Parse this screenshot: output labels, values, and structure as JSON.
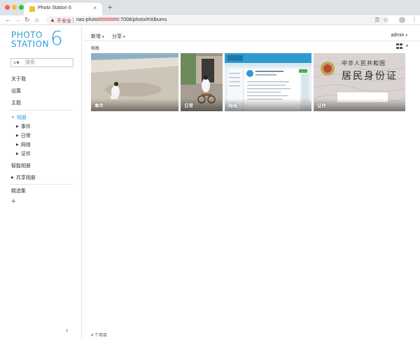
{
  "browser": {
    "tab_title": "Photo Station 6",
    "tab_close": "×",
    "new_tab": "+",
    "security_label": "不安全",
    "url_prefix": "nas-photo",
    "url_suffix": ":7008/photo/#!Albums"
  },
  "logo": {
    "line1": "PHOTO",
    "line2": "STATION",
    "version": "6"
  },
  "sidebar": {
    "search_placeholder": "搜索",
    "items": [
      {
        "label": "关于我"
      },
      {
        "label": "设置"
      },
      {
        "label": "主题"
      }
    ],
    "albums": {
      "label": "相册",
      "children": [
        {
          "label": "事件"
        },
        {
          "label": "日常"
        },
        {
          "label": "网络"
        },
        {
          "label": "证件"
        }
      ]
    },
    "smart_albums": "智能相册",
    "shared_albums": "共享相册",
    "featured": "精选集",
    "add": "+",
    "collapse": "‹"
  },
  "header": {
    "new_menu": "新增",
    "share_menu": "分享",
    "user": "admin",
    "breadcrumb": "相册"
  },
  "albums": [
    {
      "label": "事件"
    },
    {
      "label": "日常"
    },
    {
      "label": "网络"
    },
    {
      "label": "证件",
      "card_title": "中华人民共和国",
      "card_subtitle": "居民身份证"
    }
  ],
  "footer": {
    "count": "4 个项目"
  }
}
